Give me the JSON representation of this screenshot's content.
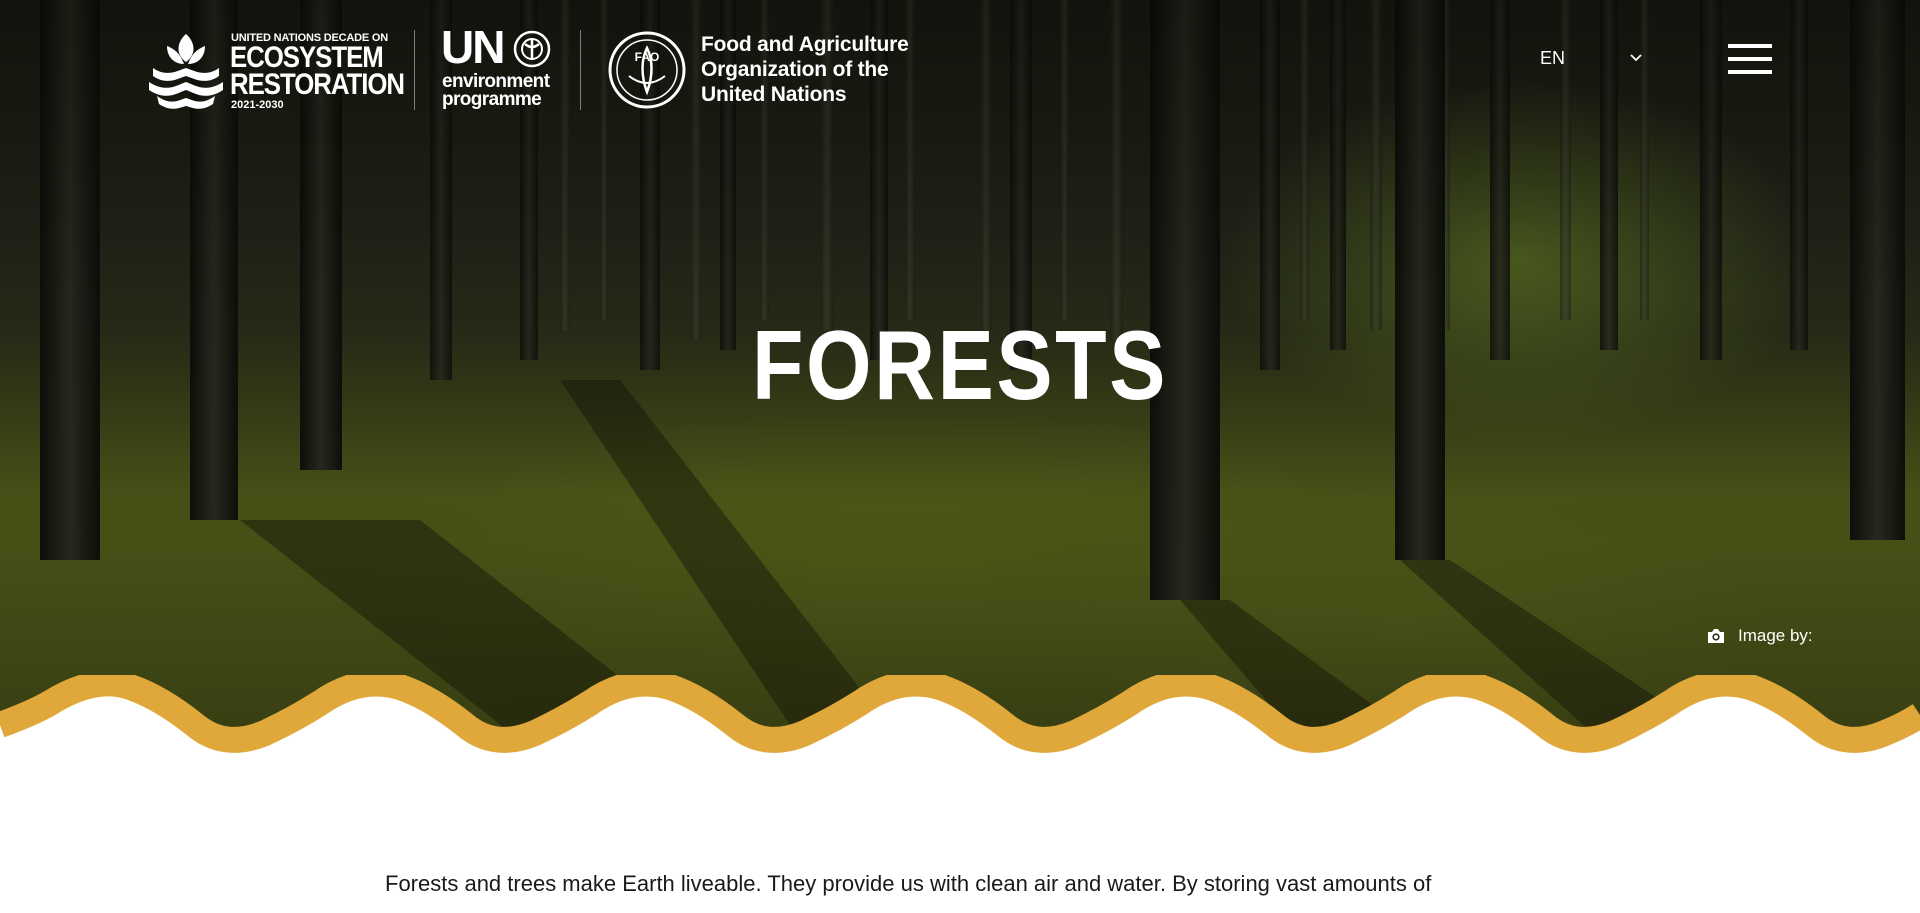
{
  "header": {
    "logos": {
      "ecosystem": {
        "line_small": "UNITED NATIONS DECADE ON",
        "line1": "ECOSYSTEM",
        "line2": "RESTORATION",
        "years": "2021-2030"
      },
      "unep": {
        "mark": "UN",
        "line1": "environment",
        "line2": "programme"
      },
      "fao": {
        "emblem_letters": "FAO",
        "line1": "Food and Agriculture",
        "line2": "Organization of the",
        "line3": "United Nations"
      }
    },
    "language": {
      "selected": "EN",
      "icon": "chevron-down-icon"
    },
    "menu_icon": "hamburger-menu-icon"
  },
  "hero": {
    "title": "FORESTS",
    "image_credit_label": "Image by:",
    "credit_icon": "camera-icon",
    "wave_color": "#E0A83A"
  },
  "content": {
    "intro": "Forests and trees make Earth liveable. They provide us with clean air and water. By storing vast amounts of"
  },
  "colors": {
    "accent": "#E0A83A",
    "hero_text": "#FFFFFF",
    "body_text": "#1A1A1A"
  }
}
